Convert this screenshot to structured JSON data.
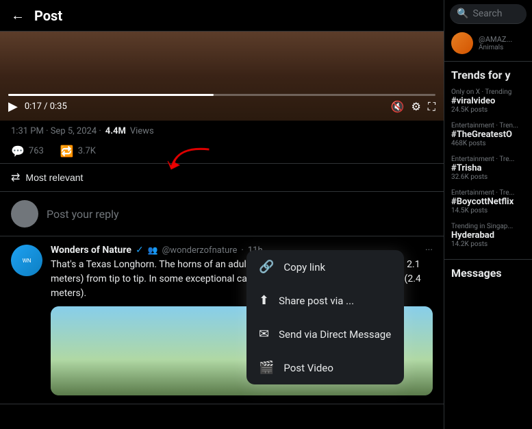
{
  "header": {
    "back_label": "←",
    "title": "Post"
  },
  "video": {
    "time": "0:17 / 0:35",
    "progress_percent": 48
  },
  "post_meta": {
    "time": "1:31 PM · Sep 5, 2024 ·",
    "views": "4.4M",
    "views_label": "Views"
  },
  "actions": {
    "comments": "763",
    "retweets": "3.7K"
  },
  "context_menu": {
    "items": [
      {
        "icon": "🔗",
        "label": "Copy link"
      },
      {
        "icon": "↑",
        "label": "Share post via ..."
      },
      {
        "icon": "✉",
        "label": "Send via Direct Message"
      },
      {
        "icon": "🎬",
        "label": "Post Video"
      }
    ]
  },
  "sort": {
    "label": "Most relevant",
    "icon": "⇄"
  },
  "reply_placeholder": "Post your reply",
  "reply_post": {
    "display_name": "Wonders of Nature",
    "verified": true,
    "handle": "@wonderzofnature",
    "time": "11h",
    "text": "That's a Texas Longhorn. The horns of an adult can span between 4 to 7 feet (1.2 to 2.1 meters) from tip to tip. In some exceptional cases, the horn span can exceed 8 feet (2.4 meters)."
  },
  "right_panel": {
    "search_placeholder": "Search",
    "profile": {
      "handle": "@AMAZ...",
      "sub": "Animals"
    },
    "trends_title": "Trends for y",
    "trends": [
      {
        "category": "Only on X · Trending",
        "tag": "#viralvideo",
        "count": "24.5K posts"
      },
      {
        "category": "Entertainment · Tren...",
        "tag": "#TheGreatestO",
        "count": "468K posts"
      },
      {
        "category": "Entertainment · Tre...",
        "tag": "#Trisha",
        "count": "32.6K posts"
      },
      {
        "category": "Entertainment · Tre...",
        "tag": "#BoycottNetflix",
        "count": "14.5K posts"
      },
      {
        "category": "Trending in Singap...",
        "tag": "Hyderabad",
        "count": "14.2K posts"
      }
    ],
    "messages_title": "Messages"
  }
}
